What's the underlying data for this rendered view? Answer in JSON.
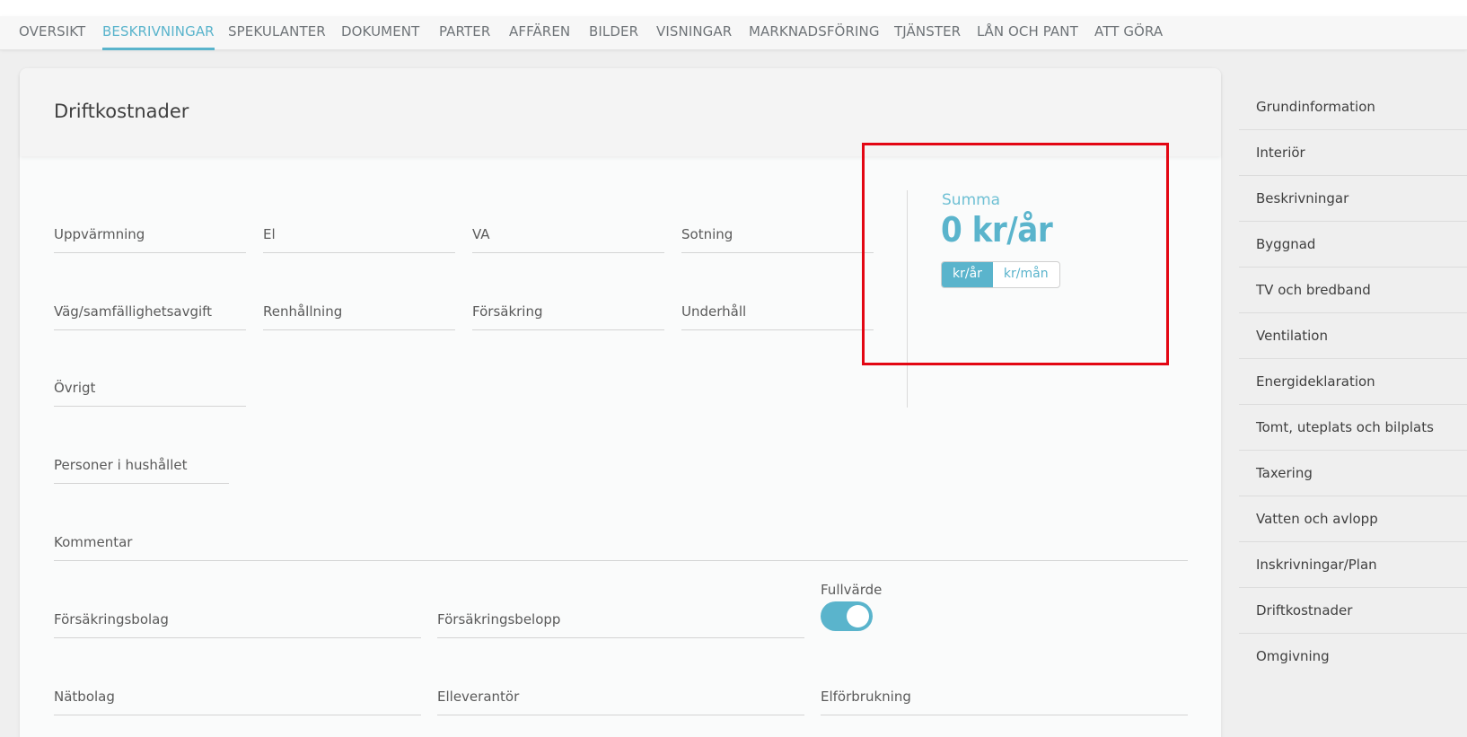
{
  "nav": {
    "items": [
      "OVERSIKT",
      "BESKRIVNINGAR",
      "SPEKULANTER",
      "DOKUMENT",
      "PARTER",
      "AFFÄREN",
      "BILDER",
      "VISNINGAR",
      "MARKNADSFÖRING",
      "TJÄNSTER",
      "LÅN OCH PANT",
      "ATT GÖRA"
    ],
    "active": "BESKRIVNINGAR"
  },
  "section": {
    "title": "Driftkostnader"
  },
  "fields": {
    "uppvarmning": "Uppvärmning",
    "el": "El",
    "va": "VA",
    "sotning": "Sotning",
    "vag": "Väg/samfällighetsavgift",
    "renhallning": "Renhållning",
    "forsakring": "Försäkring",
    "underhall": "Underhåll",
    "ovrigt": "Övrigt",
    "personer": "Personer i hushållet",
    "kommentar": "Kommentar",
    "forsakringsbolag": "Försäkringsbolag",
    "forsakringsbelopp": "Försäkringsbelopp",
    "natbolag": "Nätbolag",
    "elleverantor": "Elleverantör",
    "elforbrukning": "Elförbrukning"
  },
  "summa": {
    "label": "Summa",
    "value": "0 kr/år",
    "unit_options": [
      "kr/år",
      "kr/mån"
    ],
    "unit_selected": "kr/år"
  },
  "fullvarde": {
    "label": "Fullvärde",
    "on": true
  },
  "sidebar": {
    "items": [
      "Grundinformation",
      "Interiör",
      "Beskrivningar",
      "Byggnad",
      "TV och bredband",
      "Ventilation",
      "Energideklaration",
      "Tomt, uteplats och bilplats",
      "Taxering",
      "Vatten och avlopp",
      "Inskrivningar/Plan",
      "Driftkostnader",
      "Omgivning"
    ]
  },
  "colors": {
    "accent": "#5ab4cc",
    "highlight_box": "#e30613"
  }
}
